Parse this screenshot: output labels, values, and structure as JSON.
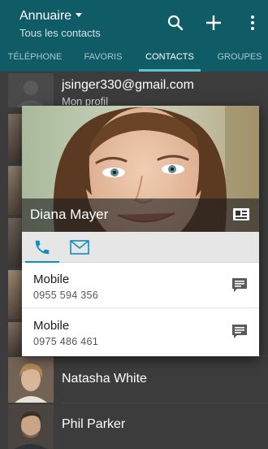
{
  "appbar": {
    "title": "Annuaire",
    "subtitle": "Tous les contacts",
    "icons": [
      "search-icon",
      "add-icon",
      "overflow-menu-icon"
    ]
  },
  "tabs": [
    {
      "label": "TÉLÉPHONE",
      "active": false
    },
    {
      "label": "FAVORIS",
      "active": false
    },
    {
      "label": "CONTACTS",
      "active": true
    },
    {
      "label": "GROUPES",
      "active": false
    }
  ],
  "list": {
    "my_profile": {
      "email": "jsinger330@gmail.com",
      "label": "Mon profil"
    },
    "contacts": [
      "Natasha White",
      "Phil Parker"
    ]
  },
  "card": {
    "name": "Diana Mayer",
    "tabs": [
      "phone-icon",
      "email-icon"
    ],
    "entries": [
      {
        "label": "Mobile",
        "number": "0955 594 356"
      },
      {
        "label": "Mobile",
        "number": "0975 486 461"
      }
    ]
  },
  "colors": {
    "appbar": "#0f5c66",
    "tab_indicator": "#5fc3cf",
    "card_tab_indicator": "#0d8fbf",
    "list_background": "#3c3c3c"
  }
}
